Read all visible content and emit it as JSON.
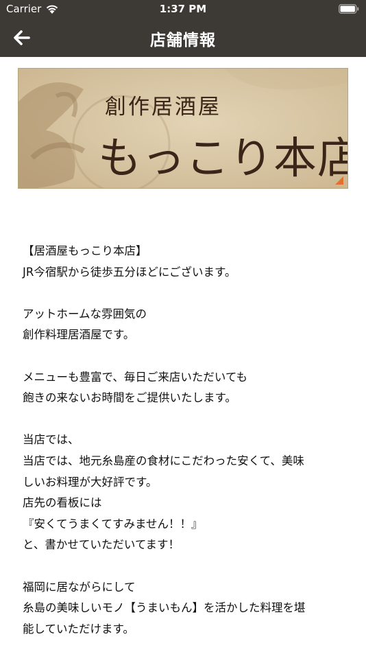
{
  "status_bar": {
    "carrier": "Carrier",
    "time": "1:37 PM"
  },
  "nav": {
    "title": "店舗情報",
    "back_icon": "arrow-left-icon"
  },
  "banner": {
    "subtitle": "創作居酒屋",
    "title": "もっこり本店",
    "colors": {
      "background": "#d9c8a7",
      "ink": "#3b2418",
      "corner_accent": "#e2712d"
    }
  },
  "description": {
    "lines": [
      "【居酒屋もっこり本店】",
      "JR今宿駅から徒歩五分ほどにございます。",
      "",
      "アットホームな雰囲気の",
      "創作料理居酒屋です。",
      "",
      "メニューも豊富で、毎日ご来店いただいても",
      "飽きの来ないお時間をご提供いたします。",
      "",
      "当店では、",
      "当店では、地元糸島産の食材にこだわった安くて、美味",
      "しいお料理が大好評です。",
      "店先の看板には",
      "『安くてうまくてすみません！！』",
      "と、書かせていただいてます！",
      "",
      "福岡に居ながらにして",
      "糸島の美味しいモノ【うまいもん】を活かした料理を堪",
      "能していただけます。"
    ]
  },
  "colors": {
    "nav_background": "#3d3a36",
    "nav_text": "#ffffff",
    "body_text": "#111111"
  }
}
